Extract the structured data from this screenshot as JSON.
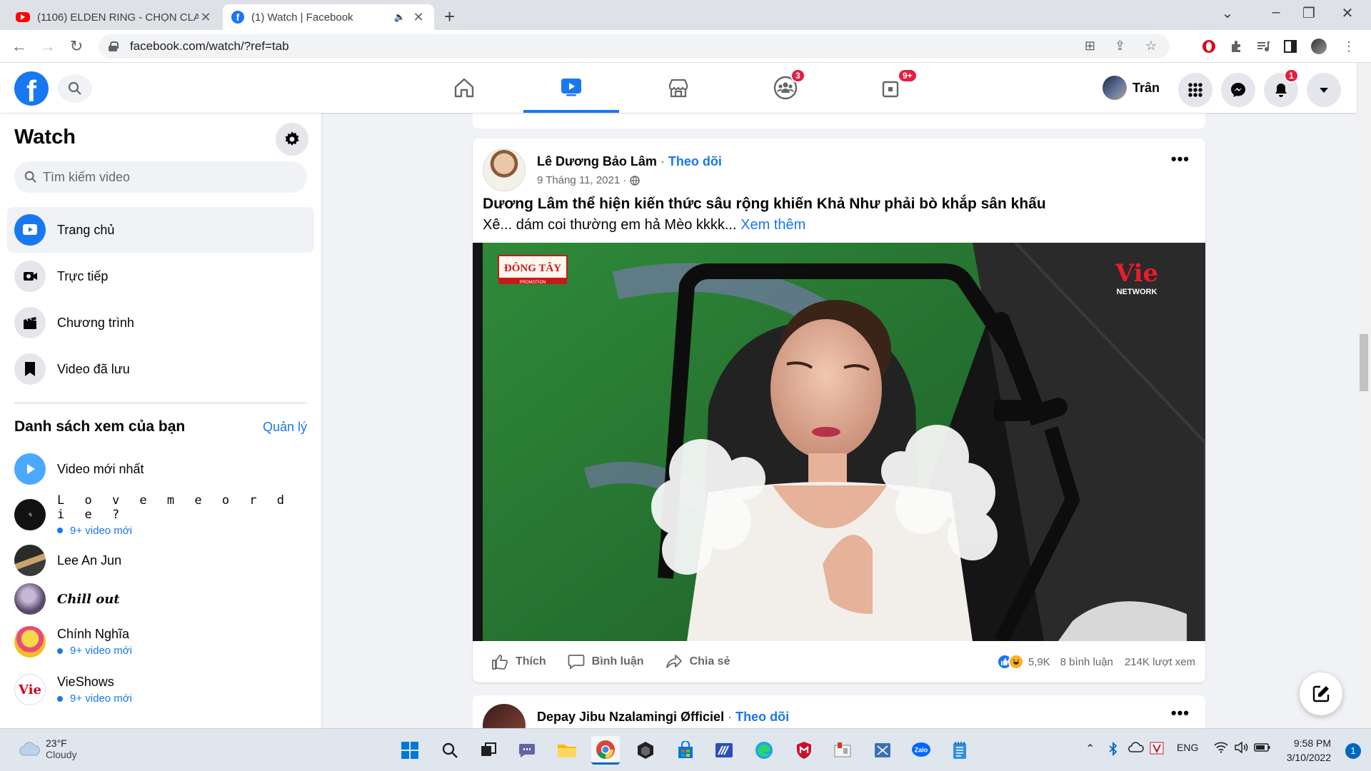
{
  "browser": {
    "tabs": [
      {
        "title": "(1106) ELDEN RING - CHỌN CLA",
        "active": false
      },
      {
        "title": "(1) Watch | Facebook",
        "active": true
      }
    ],
    "url": "facebook.com/watch/?ref=tab"
  },
  "header": {
    "logo": "f",
    "badges": {
      "groups": "3",
      "gaming": "9+",
      "notifications": "1"
    },
    "profile_name": "Trân"
  },
  "sidebar": {
    "title": "Watch",
    "search_placeholder": "Tìm kiếm video",
    "items": [
      {
        "label": "Trang chủ",
        "icon": "play-screen-icon"
      },
      {
        "label": "Trực tiếp",
        "icon": "live-camera-icon"
      },
      {
        "label": "Chương trình",
        "icon": "clapper-icon"
      },
      {
        "label": "Video đã lưu",
        "icon": "bookmark-icon"
      }
    ],
    "section_title": "Danh sách xem của bạn",
    "manage_label": "Quản lý",
    "subscriptions": [
      {
        "name": "Video mới nhất",
        "meta": ""
      },
      {
        "name": "L o v e   m e   o r   d i e  ?",
        "meta": "9+ video mới"
      },
      {
        "name": "Lee An Jun",
        "meta": ""
      },
      {
        "name": "Chill out",
        "meta": ""
      },
      {
        "name": "Chính Nghĩa",
        "meta": "9+ video mới"
      },
      {
        "name": "VieShows",
        "meta": "9+ video mới"
      }
    ]
  },
  "post": {
    "author": "Lê Dương Bảo Lâm",
    "follow": "Theo dõi",
    "date": "9 Tháng 11, 2021",
    "title": "Dương Lâm thể hiện kiến thức sâu rộng khiến Khả Như phải bò khắp sân khấu",
    "text": "Xê... dám coi thường em hả Mèo kkkk...",
    "see_more": "Xem thêm",
    "video_logo_left": "ĐÔNG TÂY",
    "video_logo_left_sub": "PROMOTION",
    "video_logo_right": "Vie",
    "video_logo_right_sub": "NETWORK",
    "actions": {
      "like": "Thích",
      "comment": "Bình luận",
      "share": "Chia sẻ"
    },
    "reactions": "5,9K",
    "comments": "8 bình luận",
    "views": "214K lượt xem"
  },
  "next_post": {
    "author": "Depay Jibu Nzalamingi Øfficiel",
    "follow": "Theo dõi"
  },
  "taskbar": {
    "temperature": "23°F",
    "condition": "Cloudy",
    "language": "ENG",
    "time": "9:58 PM",
    "date": "3/10/2022",
    "notification_count": "1"
  },
  "colors": {
    "facebook_blue": "#1877f2",
    "badge_red": "#e41e3f"
  }
}
